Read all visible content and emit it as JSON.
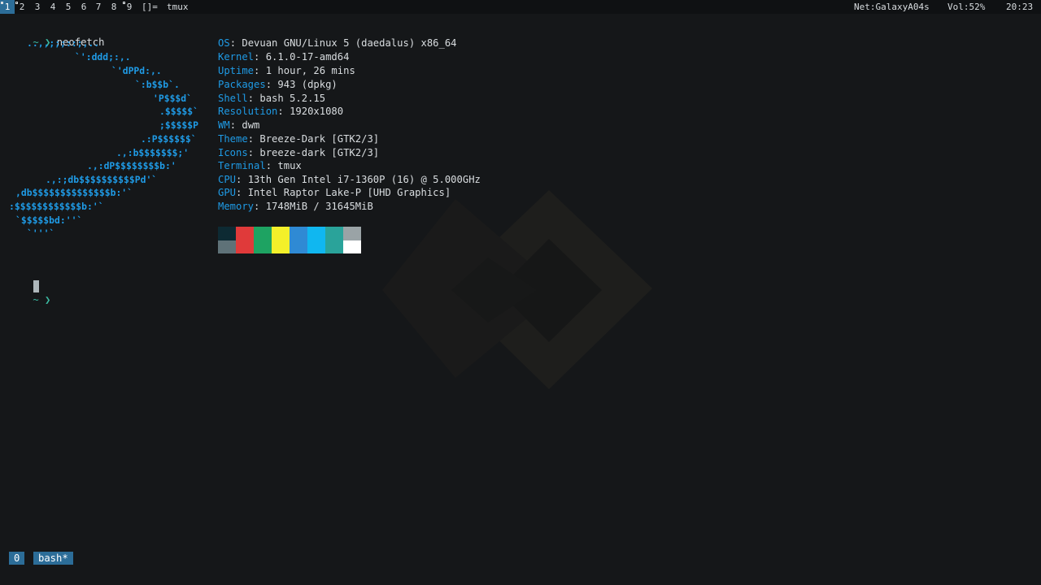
{
  "topbar": {
    "tags": [
      "1",
      "2",
      "3",
      "4",
      "5",
      "6",
      "7",
      "8",
      "9"
    ],
    "layout": "[]=",
    "window_title": "tmux",
    "net": "Net:GalaxyA04s",
    "vol": "Vol:52%",
    "clock": "20:23"
  },
  "terminal": {
    "prompt_symbol": "~ ❯",
    "command": "neofetch",
    "art_lines": [
      "..,,;;;::;,..",
      "`':ddd;:,.",
      "`'dPPd:,.",
      "`:b$$b`.",
      "'P$$$d`",
      ".$$$$$`",
      ";$$$$$P",
      ".:P$$$$$$`",
      ".,:b$$$$$$$;'",
      ".,:dP$$$$$$$$b:'",
      ".,:;db$$$$$$$$$$Pd'`",
      ",db$$$$$$$$$$$$$$b:'`",
      ":$$$$$$$$$$$$b:'`",
      "`$$$$$bd:''`",
      "`'''`"
    ],
    "info": [
      {
        "key": "OS",
        "value": "Devuan GNU/Linux 5 (daedalus) x86_64"
      },
      {
        "key": "Kernel",
        "value": "6.1.0-17-amd64"
      },
      {
        "key": "Uptime",
        "value": "1 hour, 26 mins"
      },
      {
        "key": "Packages",
        "value": "943 (dpkg)"
      },
      {
        "key": "Shell",
        "value": "bash 5.2.15"
      },
      {
        "key": "Resolution",
        "value": "1920x1080"
      },
      {
        "key": "WM",
        "value": "dwm"
      },
      {
        "key": "Theme",
        "value": "Breeze-Dark [GTK2/3]"
      },
      {
        "key": "Icons",
        "value": "breeze-dark [GTK2/3]"
      },
      {
        "key": "Terminal",
        "value": "tmux"
      },
      {
        "key": "CPU",
        "value": "13th Gen Intel i7-1360P (16) @ 5.000GHz"
      },
      {
        "key": "GPU",
        "value": "Intel Raptor Lake-P [UHD Graphics]"
      },
      {
        "key": "Memory",
        "value": "1748MiB / 31645MiB"
      }
    ],
    "palette_top": [
      "#0d2a33",
      "#e03a3a",
      "#1ea362",
      "#f4f02a",
      "#2f8ad4",
      "#10b7f0",
      "#2aa39a",
      "#9aa3a6"
    ],
    "palette_bottom": [
      "#5f7278",
      "#e03a3a",
      "#1ea362",
      "#f4f02a",
      "#2f8ad4",
      "#10b7f0",
      "#2aa39a",
      "#ffffff"
    ]
  },
  "tmux": {
    "session": "0",
    "window": "bash*"
  }
}
